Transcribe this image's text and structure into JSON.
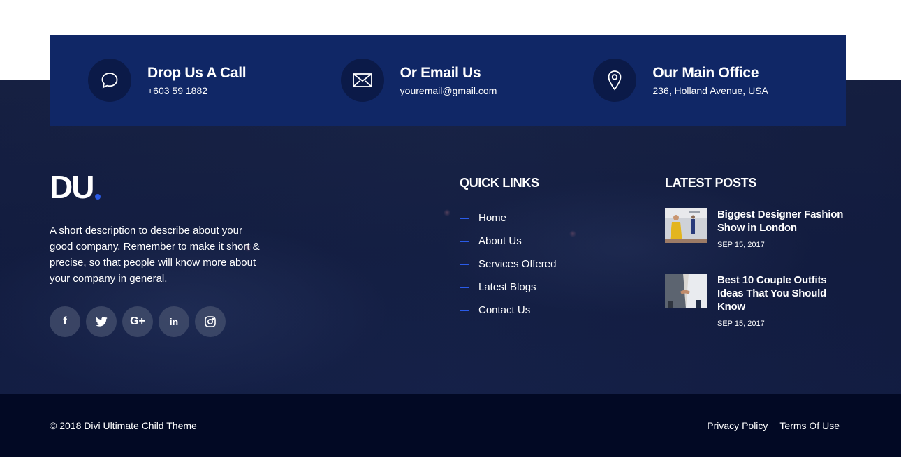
{
  "contact": [
    {
      "title": "Drop Us A Call",
      "value": "+603 59 1882",
      "icon": "chat-bubble-icon"
    },
    {
      "title": "Or Email Us",
      "value": "youremail@gmail.com",
      "icon": "envelope-icon"
    },
    {
      "title": "Our Main Office",
      "value": "236, Holland Avenue, USA",
      "icon": "map-pin-icon"
    }
  ],
  "brand": {
    "logo": "DU",
    "accent": "#2a5be8"
  },
  "about": "A short description to describe about your good company. Remember to make it short & precise, so that people will know more about your company in general.",
  "socials": [
    {
      "icon": "facebook-icon",
      "glyph": "f"
    },
    {
      "icon": "twitter-icon",
      "glyph": ""
    },
    {
      "icon": "google-plus-icon",
      "glyph": "G+"
    },
    {
      "icon": "linkedin-icon",
      "glyph": "in"
    },
    {
      "icon": "instagram-icon",
      "glyph": ""
    }
  ],
  "quick_links": {
    "title": "QUICK LINKS",
    "items": [
      "Home",
      "About Us",
      "Services Offered",
      "Latest Blogs",
      "Contact Us"
    ]
  },
  "latest_posts": {
    "title": "LATEST POSTS",
    "items": [
      {
        "title": "Biggest Designer Fashion Show in London",
        "date": "SEP 15, 2017"
      },
      {
        "title": "Best 10 Couple Outfits Ideas That You Should Know",
        "date": "SEP 15, 2017"
      }
    ]
  },
  "footer": {
    "copyright": "© 2018 Divi Ultimate Child Theme",
    "links": [
      "Privacy Policy",
      "Terms Of Use"
    ]
  },
  "colors": {
    "contact_bar": "#102766",
    "bottom_bar": "#020924",
    "accent": "#2a5be8"
  }
}
